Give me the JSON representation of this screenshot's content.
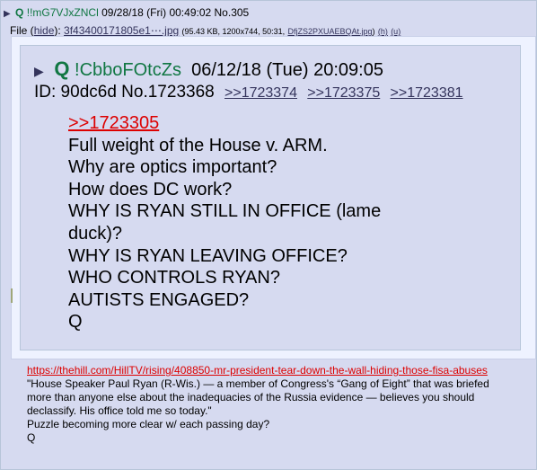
{
  "header": {
    "name": "Q",
    "tripcode": "!!mG7VJxZNCl",
    "datetime": "09/28/18 (Fri) 00:49:02",
    "post_no": "No.305"
  },
  "file": {
    "label": "File",
    "hide": "hide",
    "filename": "3f43400171805e1⋯.jpg",
    "info": "(95.43 KB, 1200x744, 50:31,",
    "orig": "DfjZS2PXUAEBQAt.jpg",
    "h": "(h)",
    "u": "(u)"
  },
  "embedded_post": {
    "name": "Q",
    "tripcode": "!CbboFOtcZs",
    "datetime": "06/12/18 (Tue) 20:09:05",
    "id_no": "ID: 90dc6d No.1723368",
    "replies": [
      ">>1723374",
      ">>1723375",
      ">>1723381"
    ],
    "quotelink": ">>1723305",
    "lines": [
      "Full weight of the House v. ARM.",
      "Why are optics important?",
      "How does DC work?",
      "WHY IS RYAN STILL IN OFFICE (lame duck)?",
      "WHY IS RYAN LEAVING OFFICE?",
      "WHO CONTROLS RYAN?",
      "AUTISTS ENGAGED?",
      "Q"
    ]
  },
  "post_body": {
    "url": "https://thehill.com/HillTV/rising/408850-mr-president-tear-down-the-wall-hiding-those-fisa-abuses",
    "lines": [
      "\"House Speaker Paul Ryan (R-Wis.) — a member of Congress's “Gang of Eight” that was briefed more than anyone else about the inadequacies of the Russia evidence — believes you should declassify. His office told me so today.\"",
      "Puzzle becoming more clear w/ each passing day?",
      "Q"
    ]
  },
  "colors": {
    "post_bg": "#d6daf0",
    "name_green": "#117743",
    "quote_red": "#dd0000",
    "link_blue": "#34345c"
  }
}
